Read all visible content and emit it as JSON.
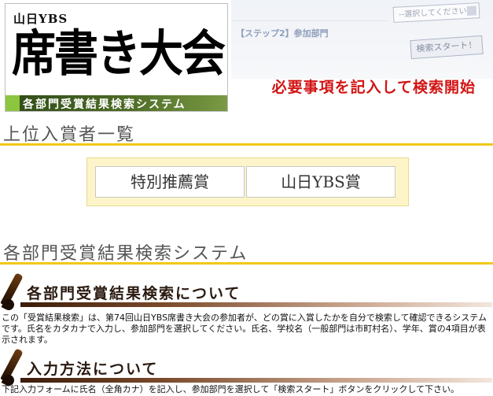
{
  "banner": {
    "brand_small": "山日YBS",
    "brand_big": "席書き大会",
    "subtitle": "各部門受賞結果検索システム",
    "tagline": "必要事項を記入して検索開始",
    "mock_step": "【ステップ2】参加部門",
    "mock_select": "--選択してください--",
    "mock_button": "検索スタート！"
  },
  "ranking": {
    "heading": "上位入賞者一覧",
    "awards": [
      {
        "label": "特別推薦賞"
      },
      {
        "label": "山日YBS賞"
      }
    ]
  },
  "search": {
    "heading": "各部門受賞結果検索システム",
    "about_heading": "各部門受賞結果検索について",
    "about_text": "この「受賞結果検索」は、第74回山日YBS席書き大会の参加者が、どの賞に入賞したかを自分で検索して確認できるシステムです。氏名をカタカナで入力し、参加部門を選択してください。氏名、学校名（一般部門は市町村名）、学年、賞の4項目が表示されます。",
    "input_heading": "入力方法について",
    "input_text": "下記入力フォームに氏名（全角カナ）を記入し、参加部門を選択して「検索スタート」ボタンをクリックして下さい。"
  },
  "colors": {
    "accent_yellow": "#f2c818",
    "tagline_red": "#d21414",
    "subtitle_green": "#3e5a1e",
    "awards_bg": "#fdf5c9"
  }
}
